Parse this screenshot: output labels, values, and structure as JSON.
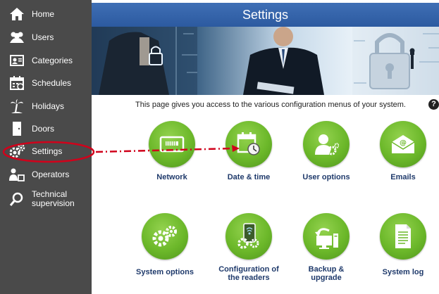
{
  "sidebar": {
    "items": [
      {
        "label": "Home",
        "icon": "home-icon"
      },
      {
        "label": "Users",
        "icon": "users-icon"
      },
      {
        "label": "Categories",
        "icon": "categories-icon"
      },
      {
        "label": "Schedules",
        "icon": "calendar-icon"
      },
      {
        "label": "Holidays",
        "icon": "palm-tree-icon"
      },
      {
        "label": "Doors",
        "icon": "door-icon"
      },
      {
        "label": "Settings",
        "icon": "gears-icon"
      },
      {
        "label": "Operators",
        "icon": "operator-icon"
      },
      {
        "label": "Technical supervision",
        "label_line1": "Technical",
        "label_line2": "supervision",
        "icon": "magnifier-icon"
      }
    ],
    "selected": "Settings"
  },
  "header": {
    "title": "Settings"
  },
  "main": {
    "intro": "This page gives you access to the various configuration menus of your system.",
    "help_glyph": "?",
    "tiles": [
      {
        "label": "Network",
        "icon": "network-icon"
      },
      {
        "label": "Date & time",
        "icon": "calendar-clock-icon"
      },
      {
        "label": "User options",
        "icon": "user-gear-icon"
      },
      {
        "label": "Emails",
        "icon": "email-icon"
      },
      {
        "label": "System options",
        "icon": "gears-icon"
      },
      {
        "label": "Configuration of the readers",
        "label_line1": "Configuration of",
        "label_line2": "the readers",
        "icon": "reader-icon"
      },
      {
        "label": "Backup & upgrade",
        "label_line1": "Backup &",
        "label_line2": "upgrade",
        "icon": "computer-backup-icon"
      },
      {
        "label": "System log",
        "icon": "document-icon"
      }
    ]
  },
  "colors": {
    "sidebar_bg": "#4a4a4a",
    "title_bar": "#3567b0",
    "tile_green": "#6cb82a",
    "tile_label": "#1f3a6b",
    "highlight_red": "#d0021b"
  }
}
